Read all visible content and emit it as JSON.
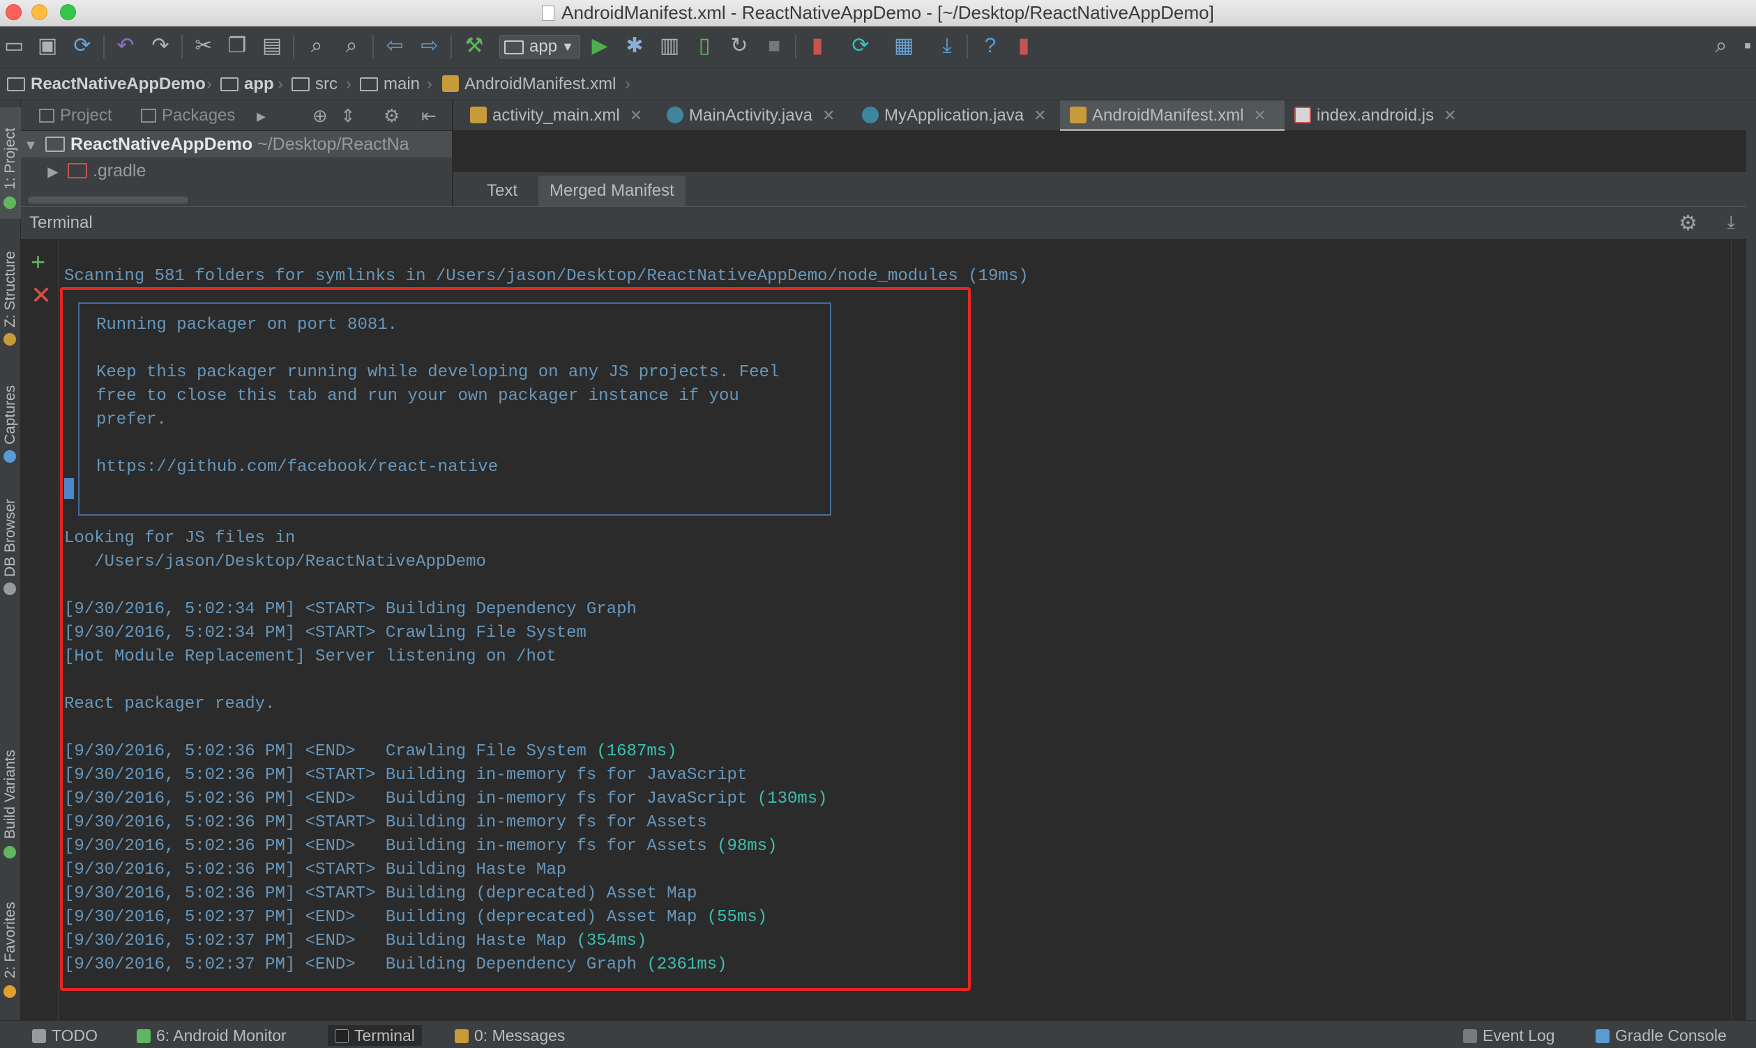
{
  "window": {
    "title": "AndroidManifest.xml - ReactNativeAppDemo - [~/Desktop/ReactNativeAppDemo]"
  },
  "toolbar": {
    "run_config": "app",
    "icons": [
      "open-icon",
      "save-icon",
      "sync-icon",
      "undo-icon",
      "redo-icon",
      "cut-icon",
      "copy-icon",
      "paste-icon",
      "find-icon",
      "replace-icon",
      "back-icon",
      "forward-icon",
      "make-icon",
      "run-icon",
      "debug-icon",
      "coverage-icon",
      "profile-icon",
      "attach-icon",
      "stop-icon",
      "avd-icon",
      "gradle-sync-icon",
      "project-structure-icon",
      "sdk-icon",
      "help-icon",
      "monitor-icon"
    ],
    "search_icon": "search-icon"
  },
  "breadcrumb": {
    "items": [
      "ReactNativeAppDemo",
      "app",
      "src",
      "main",
      "AndroidManifest.xml"
    ]
  },
  "left_stripe": {
    "tabs": [
      "1: Project",
      "Z: Structure",
      "Captures",
      "DB Browser",
      "Build Variants",
      "2: Favorites"
    ]
  },
  "project_panel": {
    "tab_project": "Project",
    "tab_packages": "Packages",
    "root_name": "ReactNativeAppDemo",
    "root_path": "~/Desktop/ReactNa",
    "child": ".gradle"
  },
  "editor": {
    "tabs": [
      {
        "label": "activity_main.xml",
        "kind": "xml"
      },
      {
        "label": "MainActivity.java",
        "kind": "java"
      },
      {
        "label": "MyApplication.java",
        "kind": "java"
      },
      {
        "label": "AndroidManifest.xml",
        "kind": "xml"
      },
      {
        "label": "index.android.js",
        "kind": "js"
      }
    ],
    "active_tab": "AndroidManifest.xml",
    "subtabs": [
      "Text",
      "Merged Manifest"
    ]
  },
  "terminal": {
    "title": "Terminal",
    "scan_line": "Scanning 581 folders for symlinks in /Users/jason/Desktop/ReactNativeAppDemo/node_modules (19ms)",
    "box_top": " ┌────────────────────────────────────────────────────────────────────────────┐",
    "box_lines": [
      " │  Running packager on port 8081.                                            │",
      " │                                                                            │",
      " │  Keep this packager running while developing on any JS projects. Feel      │",
      " │  free to close this tab and run your own packager instance if you          │",
      " │  prefer.                                                                   │",
      " │                                                                            │",
      " │  https://github.com/facebook/react-native                                  │",
      " │                                                                            │"
    ],
    "box_bottom": " └────────────────────────────────────────────────────────────────────────────┘",
    "looking_1": "Looking for JS files in",
    "looking_2": "   /Users/jason/Desktop/ReactNativeAppDemo",
    "log1": [
      "[9/30/2016, 5:02:34 PM] <START> Building Dependency Graph",
      "[9/30/2016, 5:02:34 PM] <START> Crawling File System",
      "[Hot Module Replacement] Server listening on /hot"
    ],
    "ready": "React packager ready.",
    "log2": [
      {
        "text": "[9/30/2016, 5:02:36 PM] <END>   Crawling File System ",
        "time": "(1687ms)"
      },
      {
        "text": "[9/30/2016, 5:02:36 PM] <START> Building in-memory fs for JavaScript",
        "time": ""
      },
      {
        "text": "[9/30/2016, 5:02:36 PM] <END>   Building in-memory fs for JavaScript ",
        "time": "(130ms)"
      },
      {
        "text": "[9/30/2016, 5:02:36 PM] <START> Building in-memory fs for Assets",
        "time": ""
      },
      {
        "text": "[9/30/2016, 5:02:36 PM] <END>   Building in-memory fs for Assets ",
        "time": "(98ms)"
      },
      {
        "text": "[9/30/2016, 5:02:36 PM] <START> Building Haste Map",
        "time": ""
      },
      {
        "text": "[9/30/2016, 5:02:36 PM] <START> Building (deprecated) Asset Map",
        "time": ""
      },
      {
        "text": "[9/30/2016, 5:02:37 PM] <END>   Building (deprecated) Asset Map ",
        "time": "(55ms)"
      },
      {
        "text": "[9/30/2016, 5:02:37 PM] <END>   Building Haste Map ",
        "time": "(354ms)"
      },
      {
        "text": "[9/30/2016, 5:02:37 PM] <END>   Building Dependency Graph ",
        "time": "(2361ms)"
      }
    ]
  },
  "statusbar": {
    "todo": "TODO",
    "android_monitor": "6: Android Monitor",
    "terminal": "Terminal",
    "messages": "0: Messages",
    "event_log": "Event Log",
    "gradle_console": "Gradle Console"
  },
  "colors": {
    "terminal_text": "#6897bb",
    "timing_text": "#3dbfb3",
    "highlight_border": "#e8271f"
  }
}
